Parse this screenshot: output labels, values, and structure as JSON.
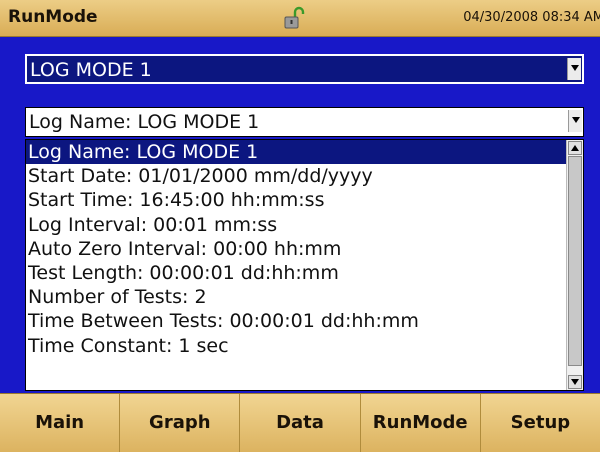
{
  "header": {
    "title": "RunMode",
    "datetime": "04/30/2008 08:34 AM",
    "lock_icon": "unlocked-padlock-icon"
  },
  "mode_select": {
    "value": "LOG MODE 1"
  },
  "log_select": {
    "value": "Log Name: LOG MODE 1"
  },
  "list": {
    "items": [
      "Log Name: LOG MODE 1",
      "Start Date: 01/01/2000 mm/dd/yyyy",
      "Start Time: 16:45:00 hh:mm:ss",
      "Log Interval: 00:01 mm:ss",
      "Auto Zero Interval: 00:00 hh:mm",
      "Test Length: 00:00:01 dd:hh:mm",
      "Number of Tests: 2",
      "Time Between Tests: 00:00:01 dd:hh:mm",
      "Time Constant: 1 sec"
    ],
    "selected_index": 0
  },
  "nav": {
    "tabs": [
      "Main",
      "Graph",
      "Data",
      "RunMode",
      "Setup"
    ]
  },
  "colors": {
    "panel_blue": "#1818c8",
    "selection_navy": "#0c1680",
    "header_gold": "#d9ad56"
  }
}
